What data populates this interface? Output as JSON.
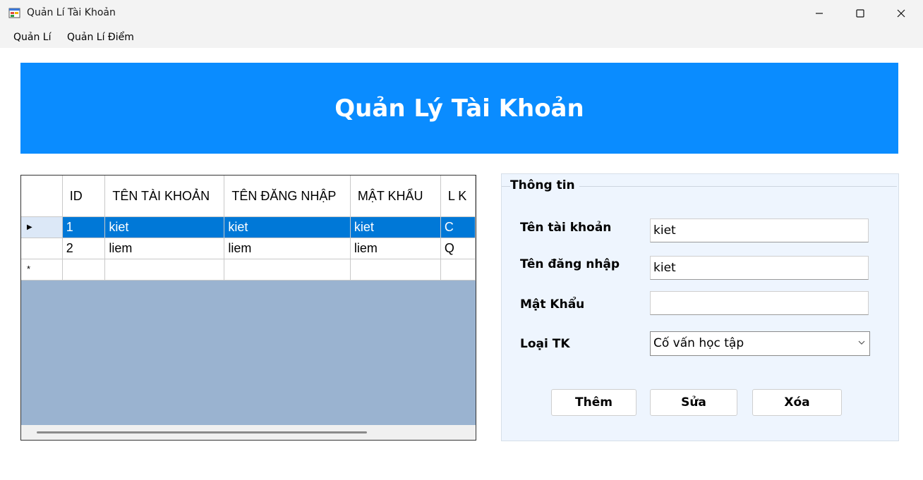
{
  "window": {
    "title": "Quản Lí Tài Khoản",
    "icon": "app-window-icon",
    "controls": [
      "minimize-icon",
      "maximize-icon",
      "close-icon"
    ]
  },
  "menu": {
    "items": [
      {
        "label": "Quản Lí"
      },
      {
        "label": "Quản Lí Điểm"
      }
    ]
  },
  "banner": {
    "title": "Quản Lý Tài Khoản",
    "color": "#0a8cff"
  },
  "grid": {
    "columns": [
      "ID",
      "TÊN TÀI KHOẢN",
      "TÊN ĐĂNG NHẬP",
      "MẬT KHẨU",
      "L K"
    ],
    "rows": [
      {
        "cells": [
          "1",
          "kiet",
          "kiet",
          "kiet",
          "C"
        ],
        "selected": true
      },
      {
        "cells": [
          "2",
          "liem",
          "liem",
          "liem",
          "Q"
        ],
        "selected": false
      }
    ],
    "new_row_marker": "*",
    "current_row_marker": "▶",
    "selection_color": "#0078d7",
    "background_color": "#9ab3d0"
  },
  "info": {
    "title": "Thông tin",
    "fields": {
      "account_name": {
        "label": "Tên tài khoản",
        "value": "kiet"
      },
      "username": {
        "label": "Tên đăng nhập",
        "value": "kiet"
      },
      "password": {
        "label": "Mật Khẩu",
        "value": ""
      },
      "account_type": {
        "label": "Loại TK",
        "value": "Cố vấn học tập"
      }
    },
    "buttons": {
      "add": "Thêm",
      "edit": "Sửa",
      "delete": "Xóa"
    }
  }
}
